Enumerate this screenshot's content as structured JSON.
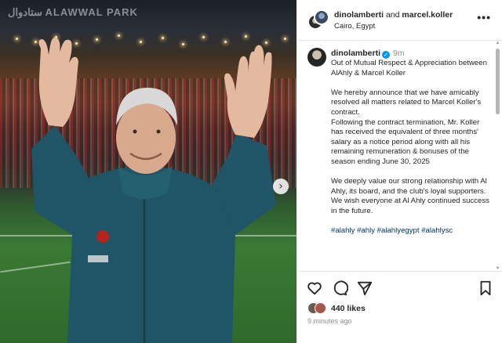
{
  "photo": {
    "stadium_sign": "ستادوال ALAWWAL PARK",
    "next_label": "›"
  },
  "post_header": {
    "user1": "dinolamberti",
    "and": "and",
    "user2": "marcel.koller",
    "location": "Cairo, Egypt",
    "more": "•••"
  },
  "caption": {
    "username": "dinolamberti",
    "verified_mark": "✓",
    "time": "9m",
    "paragraphs": [
      "Out of Mutual Respect & Appreciation between AlAhly & Marcel Koller",
      "We hereby announce that we have amicably resolved all matters related to Marcel Koller's contract.\nFollowing the contract termination, Mr. Koller has received the equivalent of three months' salary as a notice period along with all his remaining remuneration & bonuses of the season ending June 30, 2025",
      "We deeply value our strong relationship with Al Ahly, its board, and the club's loyal supporters. We wish everyone at Al Ahly continued success in the future."
    ],
    "hashtags": "#alahly #ahly #alahlyegypt #alahlysc"
  },
  "actions": {
    "likes": "440 likes",
    "time_ago": "9 minutes ago",
    "icons": [
      "heart-icon",
      "comment-icon",
      "share-icon",
      "bookmark-icon"
    ]
  },
  "colors": {
    "link": "#00376b",
    "verified": "#0095f6",
    "muted": "#8e8e8e"
  }
}
